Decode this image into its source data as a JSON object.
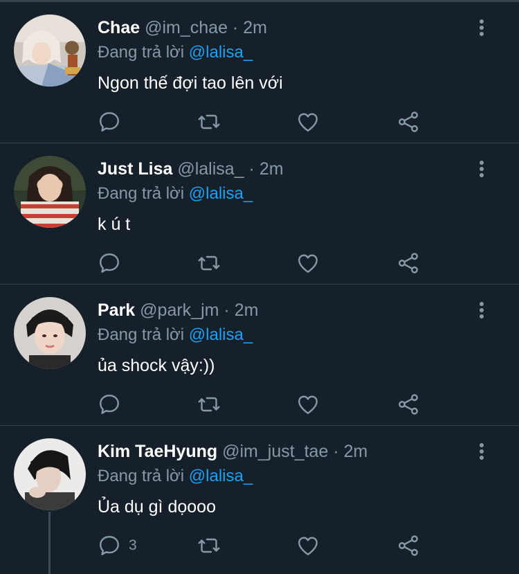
{
  "reply_prefix": "Đang trả lời",
  "colors": {
    "background": "#15202b",
    "divider": "#38444d",
    "secondary_text": "#8899a6",
    "mention": "#1da1f2"
  },
  "icons": [
    "reply-icon",
    "retweet-icon",
    "like-icon",
    "share-icon",
    "more-icon"
  ],
  "tweets": [
    {
      "name": "Chae",
      "handle": "@im_chae",
      "dot": "·",
      "time": "2m",
      "reply_to": "@lalisa_",
      "text": "Ngon thế đợi tao lên với",
      "reply_count": ""
    },
    {
      "name": "Just Lisa",
      "handle": "@lalisa_",
      "dot": "·",
      "time": "2m",
      "reply_to": "@lalisa_",
      "text": "k ú t",
      "reply_count": ""
    },
    {
      "name": "Park",
      "handle": "@park_jm",
      "dot": "·",
      "time": "2m",
      "reply_to": "@lalisa_",
      "text": "ủa shock vậy:))",
      "reply_count": ""
    },
    {
      "name": "Kim TaeHyung",
      "handle": "@im_just_tae",
      "dot": "·",
      "time": "2m",
      "reply_to": "@lalisa_",
      "text": "Ủa dụ gì dọooo",
      "reply_count": "3"
    }
  ]
}
